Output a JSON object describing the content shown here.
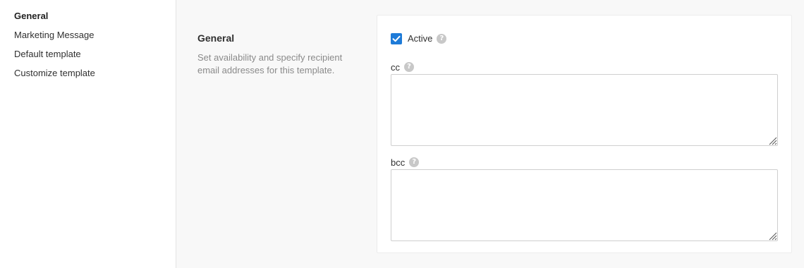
{
  "sidebar": {
    "items": [
      {
        "label": "General",
        "active": true
      },
      {
        "label": "Marketing Message",
        "active": false
      },
      {
        "label": "Default template",
        "active": false
      },
      {
        "label": "Customize template",
        "active": false
      }
    ]
  },
  "section": {
    "title": "General",
    "description_line1": "Set availability and specify recipient",
    "description_line2": "email addresses for this template."
  },
  "form": {
    "active": {
      "label": "Active",
      "checked": true
    },
    "cc": {
      "label": "cc",
      "value": "",
      "placeholder": ""
    },
    "bcc": {
      "label": "bcc",
      "value": "",
      "placeholder": ""
    },
    "help_glyph": "?"
  },
  "colors": {
    "accent": "#1e7bd8",
    "main_bg": "#f8f8f8",
    "help_icon": "#c8c8c8"
  }
}
